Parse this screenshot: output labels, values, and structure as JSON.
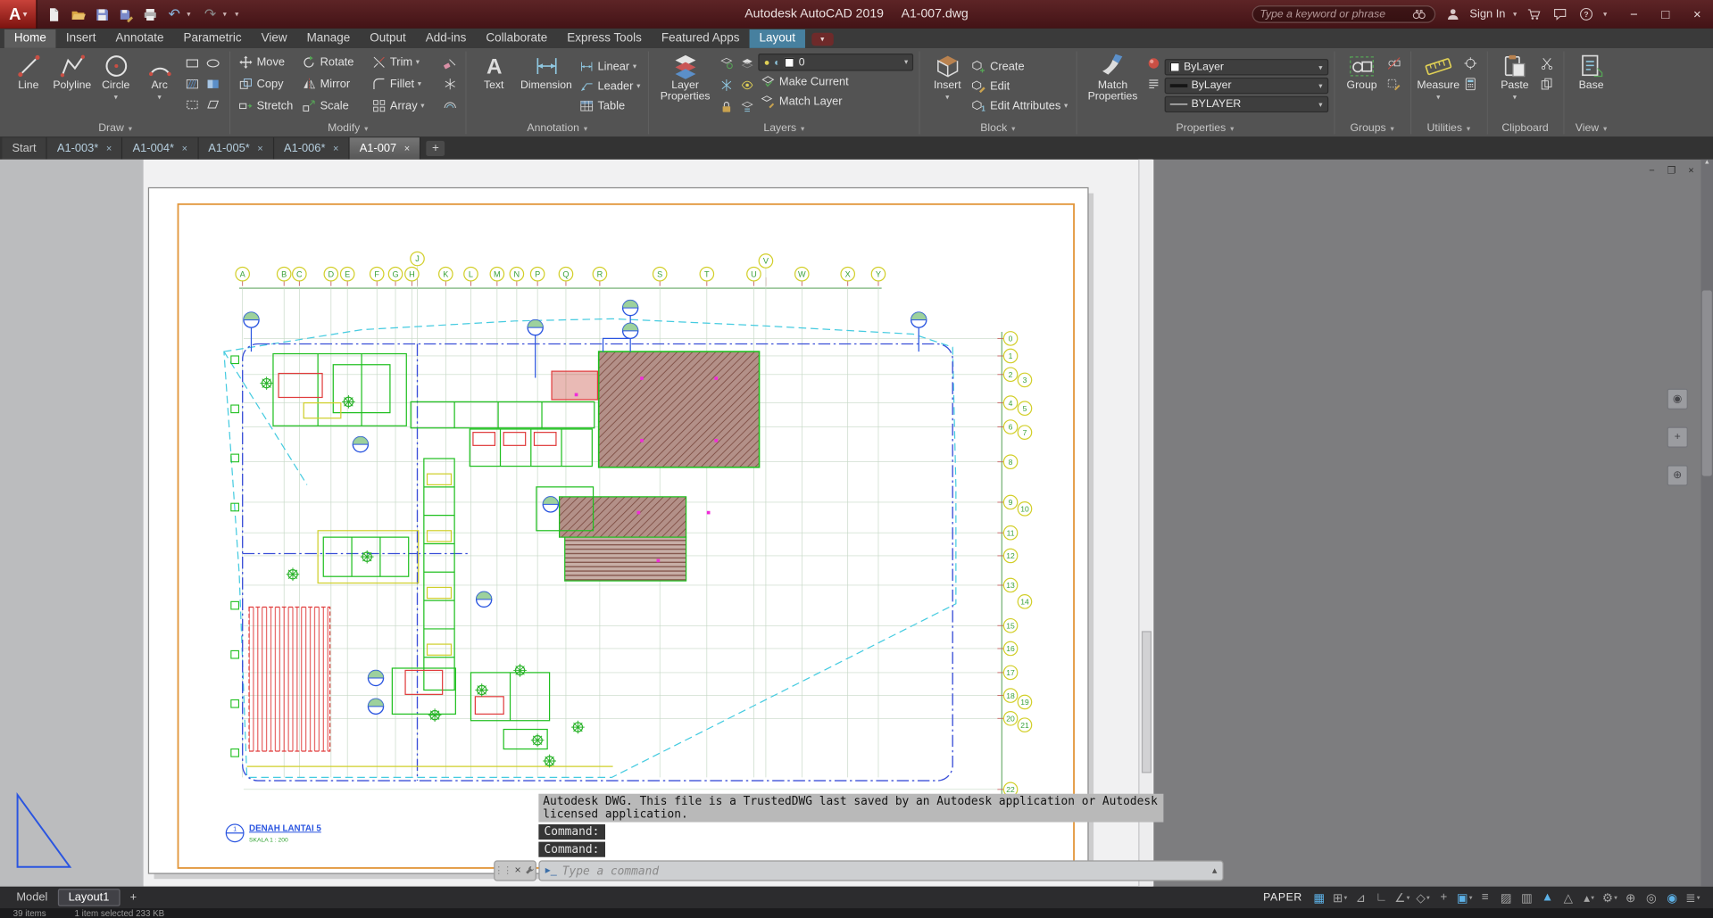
{
  "title_bar": {
    "app_title": "Autodesk AutoCAD 2019",
    "doc_title": "A1-007.dwg",
    "search_placeholder": "Type a keyword or phrase",
    "sign_in_label": "Sign In"
  },
  "quick_access": [
    "new-file",
    "open",
    "save",
    "save-as",
    "plot"
  ],
  "ribbon_tabs": [
    {
      "label": "Home",
      "state": "active"
    },
    {
      "label": "Insert"
    },
    {
      "label": "Annotate"
    },
    {
      "label": "Parametric"
    },
    {
      "label": "View"
    },
    {
      "label": "Manage"
    },
    {
      "label": "Output"
    },
    {
      "label": "Add-ins"
    },
    {
      "label": "Collaborate"
    },
    {
      "label": "Express Tools"
    },
    {
      "label": "Featured Apps"
    },
    {
      "label": "Layout",
      "state": "contextual"
    }
  ],
  "ribbon_panels": [
    {
      "label": "Draw",
      "dd": true,
      "layout": "draw",
      "big": [
        {
          "name": "line",
          "label": "Line"
        },
        {
          "name": "polyline",
          "label": "Polyline"
        },
        {
          "name": "circle",
          "label": "Circle",
          "dd": true
        },
        {
          "name": "arc",
          "label": "Arc",
          "dd": true
        }
      ],
      "small": [
        "rectangle",
        "ellipse",
        "hatch",
        "gradient",
        "boundary",
        "region"
      ]
    },
    {
      "label": "Modify",
      "dd": true,
      "layout": "grid",
      "cells": [
        {
          "name": "move",
          "label": "Move"
        },
        {
          "name": "rotate",
          "label": "Rotate"
        },
        {
          "name": "trim",
          "label": "Trim",
          "dd": true
        },
        {
          "name": "copy",
          "label": "Copy"
        },
        {
          "name": "mirror",
          "label": "Mirror"
        },
        {
          "name": "fillet",
          "label": "Fillet",
          "dd": true
        },
        {
          "name": "stretch",
          "label": "Stretch"
        },
        {
          "name": "scale",
          "label": "Scale"
        },
        {
          "name": "array",
          "label": "Array",
          "dd": true
        }
      ],
      "small": [
        "erase",
        "explode",
        "offset"
      ]
    },
    {
      "label": "Annotation",
      "dd": true,
      "layout": "annotation",
      "big": [
        {
          "name": "text",
          "label": "Text"
        },
        {
          "name": "dimension",
          "label": "Dimension"
        }
      ],
      "rows": [
        {
          "name": "linear",
          "label": "Linear",
          "dd": true
        },
        {
          "name": "leader",
          "label": "Leader",
          "dd": true
        },
        {
          "name": "table",
          "label": "Table"
        }
      ]
    },
    {
      "label": "Layers",
      "dd": true,
      "layout": "layers",
      "big": {
        "name": "layer-properties",
        "label": "Layer Properties"
      },
      "tools": [
        "layer-state",
        "layer-isolate",
        "layer-freeze",
        "layer-off",
        "layer-lock",
        "layer-walk"
      ],
      "combo_value": "0",
      "rows": [
        {
          "name": "make-current",
          "label": "Make Current"
        },
        {
          "name": "match-layer",
          "label": "Match Layer"
        }
      ]
    },
    {
      "label": "Block",
      "dd": true,
      "layout": "block",
      "big": {
        "name": "insert",
        "label": "Insert",
        "dd": true
      },
      "rows": [
        {
          "name": "create-block",
          "label": "Create"
        },
        {
          "name": "edit-block",
          "label": "Edit"
        },
        {
          "name": "edit-attributes",
          "label": "Edit Attributes",
          "dd": true
        }
      ]
    },
    {
      "label": "Properties",
      "dd": true,
      "layout": "properties",
      "big": {
        "name": "match-properties",
        "label": "Match Properties"
      },
      "tools": [
        "object-color",
        "list"
      ],
      "combos": [
        {
          "type": "color",
          "value": "ByLayer"
        },
        {
          "type": "lineweight",
          "value": "ByLayer"
        },
        {
          "type": "linetype",
          "value": "BYLAYER"
        }
      ]
    },
    {
      "label": "Groups",
      "dd": true,
      "layout": "simple",
      "big": [
        {
          "name": "group",
          "label": "Group"
        }
      ],
      "small": [
        "ungroup",
        "group-edit"
      ]
    },
    {
      "label": "Utilities",
      "dd": true,
      "layout": "simple",
      "big": [
        {
          "name": "measure",
          "label": "Measure",
          "dd": true
        }
      ],
      "small": [
        "id-point",
        "quick-calc"
      ]
    },
    {
      "label": "Clipboard",
      "dd": false,
      "layout": "simple",
      "big": [
        {
          "name": "paste",
          "label": "Paste",
          "dd": true
        }
      ],
      "small": [
        "cut",
        "copy-clip"
      ]
    },
    {
      "label": "View",
      "dd": true,
      "layout": "simple",
      "big": [
        {
          "name": "base",
          "label": "Base"
        }
      ],
      "small": []
    }
  ],
  "file_tabs": [
    {
      "label": "Start",
      "closable": false
    },
    {
      "label": "A1-003*",
      "closable": true
    },
    {
      "label": "A1-004*",
      "closable": true
    },
    {
      "label": "A1-005*",
      "closable": true
    },
    {
      "label": "A1-006*",
      "closable": true
    },
    {
      "label": "A1-007",
      "closable": true,
      "active": true
    }
  ],
  "drawing": {
    "grid_letters": [
      "A",
      "B",
      "C",
      "D",
      "E",
      "F",
      "G",
      "H",
      "J",
      "K",
      "L",
      "M",
      "N",
      "P",
      "Q",
      "R",
      "S",
      "T",
      "U",
      "V",
      "W",
      "X",
      "Y"
    ],
    "grid_numbers": [
      "0",
      "1",
      "2",
      "3",
      "4",
      "5",
      "6",
      "7",
      "8",
      "9",
      "10",
      "11",
      "12",
      "13",
      "14",
      "15",
      "16",
      "17",
      "18",
      "19",
      "20",
      "21",
      "22"
    ],
    "plan_title": "DENAH LANTAI 5",
    "plan_scale": "SKALA 1 : 200",
    "title_bubble": "1"
  },
  "command": {
    "message": "Autodesk DWG.  This file is a TrustedDWG last saved by an Autodesk application or Autodesk licensed application.",
    "prompt1": "Command:",
    "prompt2": "Command:",
    "input_placeholder": "Type a command"
  },
  "status": {
    "model_label": "Model",
    "layout_label": "Layout1",
    "new_layout_label": "+",
    "space_label": "PAPER"
  },
  "status_icons": [
    {
      "name": "grid-display",
      "glyph": "▦",
      "active": true
    },
    {
      "name": "snap-mode",
      "glyph": "⊞",
      "dd": true
    },
    {
      "name": "infer-constraints",
      "glyph": "⊿"
    },
    {
      "name": "ortho-mode",
      "glyph": "∟"
    },
    {
      "name": "polar-tracking",
      "glyph": "∠",
      "dd": true
    },
    {
      "name": "isometric-drafting",
      "glyph": "◇",
      "dd": true
    },
    {
      "name": "osnap-tracking",
      "glyph": "+"
    },
    {
      "name": "object-snap",
      "glyph": "▣",
      "active": true,
      "dd": true
    },
    {
      "name": "lineweight",
      "glyph": "≡"
    },
    {
      "name": "transparency",
      "glyph": "▨"
    },
    {
      "name": "selection-cycling",
      "glyph": "▥"
    },
    {
      "name": "annotation-visibility",
      "glyph": "▲",
      "active": true
    },
    {
      "name": "autoscale",
      "glyph": "△"
    },
    {
      "name": "annotation-scale",
      "glyph": "▴",
      "dd": true
    },
    {
      "name": "workspace-switching",
      "glyph": "⚙",
      "dd": true
    },
    {
      "name": "annotation-monitor",
      "glyph": "⊕"
    },
    {
      "name": "isolate-objects",
      "glyph": "◎"
    },
    {
      "name": "graphics-performance",
      "glyph": "◉",
      "active": true
    },
    {
      "name": "customization",
      "glyph": "≣",
      "dd": true
    }
  ],
  "taskbar": {
    "items_text": "39 items",
    "selection_text": "1 item selected 233 KB"
  },
  "colors": {
    "titlebar": "#4f1b1d",
    "ribbon": "#535353",
    "contextual_tab_blue": "#47809f",
    "paper_margin_orange": "#e2973c",
    "cad_green": "#1fbf1f",
    "cad_cyan": "#45cbe0",
    "cad_blue": "#2a55e0",
    "cad_red": "#e03c3c",
    "cad_magenta": "#f02cd8",
    "hatch_brown": "#7d4c42"
  }
}
